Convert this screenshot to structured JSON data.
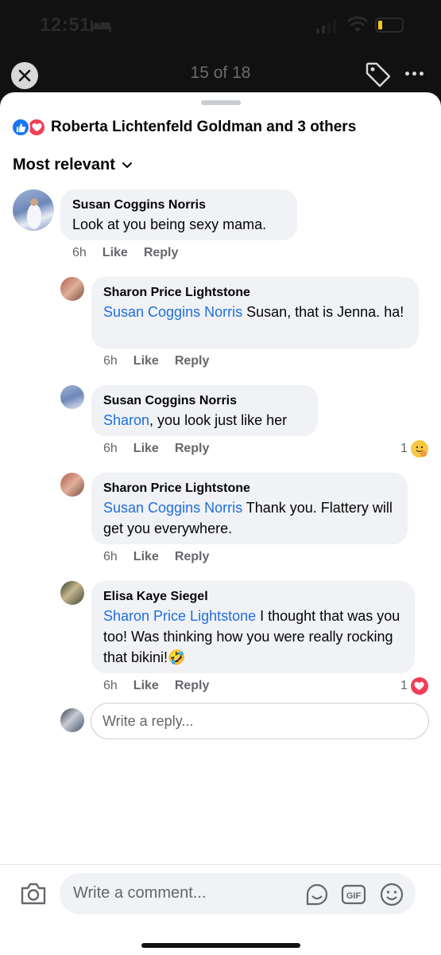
{
  "status_bar": {
    "time": "12:51"
  },
  "viewer": {
    "counter": "15 of 18"
  },
  "sheet": {
    "reactions_text": "Roberta Lichtenfeld Goldman and 3 others",
    "sort_label": "Most relevant"
  },
  "comments": [
    {
      "author": "Susan Coggins Norris",
      "mention": "",
      "text": "Look at you being sexy mama.",
      "time": "6h",
      "like": "Like",
      "reply": "Reply"
    },
    {
      "author": "Sharon Price Lightstone",
      "mention": "Susan Coggins Norris",
      "text": " Susan, that is Jenna. ha!",
      "time": "6h",
      "like": "Like",
      "reply": "Reply"
    },
    {
      "author": "Susan Coggins Norris",
      "mention": "Sharon",
      "text": ", you look just like her",
      "time": "6h",
      "like": "Like",
      "reply": "Reply",
      "reaction_count": "1",
      "reaction_icon": "hug-emoji"
    },
    {
      "author": "Sharon Price Lightstone",
      "mention": "Susan Coggins Norris",
      "text": " Thank you. Flattery will get you everywhere.",
      "time": "6h",
      "like": "Like",
      "reply": "Reply"
    },
    {
      "author": "Elisa Kaye Siegel",
      "mention": "Sharon Price Lightstone",
      "text": " I thought that was you too! Was thinking how you were really rocking that bikini!🤣",
      "time": "6h",
      "like": "Like",
      "reply": "Reply",
      "reaction_count": "1",
      "reaction_icon": "love-heart"
    }
  ],
  "reply_input": {
    "placeholder": "Write a reply..."
  },
  "comment_input": {
    "placeholder": "Write a comment..."
  },
  "colors": {
    "accent": "#1877f2",
    "mention": "#216fdb",
    "love": "#f33e58",
    "bubble": "#f0f2f5"
  }
}
